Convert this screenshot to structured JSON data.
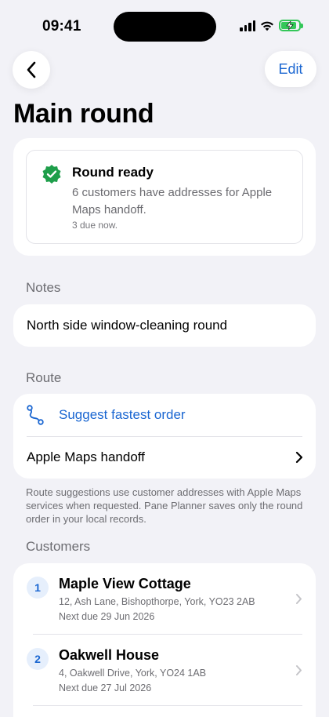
{
  "status_bar": {
    "time": "09:41"
  },
  "nav": {
    "back_icon": "chevron-left-icon",
    "edit_label": "Edit"
  },
  "title": "Main round",
  "round_status": {
    "icon": "check-seal-icon",
    "title": "Round ready",
    "description": "6 customers have addresses for Apple Maps handoff.",
    "due": "3 due now."
  },
  "notes": {
    "header": "Notes",
    "text": "North side window-cleaning round"
  },
  "route": {
    "header": "Route",
    "suggest_label": "Suggest fastest order",
    "suggest_icon": "route-icon",
    "handoff_label": "Apple Maps handoff",
    "footnote": "Route suggestions use customer addresses with Apple Maps services when requested. Pane Planner saves only the round order in your local records."
  },
  "customers": {
    "header": "Customers",
    "items": [
      {
        "number": "1",
        "name": "Maple View Cottage",
        "address": "12, Ash Lane, Bishopthorpe, York, YO23 2AB",
        "next_due": "Next due 29 Jun 2026"
      },
      {
        "number": "2",
        "name": "Oakwell House",
        "address": "4, Oakwell Drive, York, YO24 1AB",
        "next_due": "Next due 27 Jul 2026"
      }
    ]
  },
  "colors": {
    "accent": "#1a66d1",
    "success": "#1e9e4a",
    "background": "#f2f2f7",
    "secondary_text": "#6d6d72"
  }
}
